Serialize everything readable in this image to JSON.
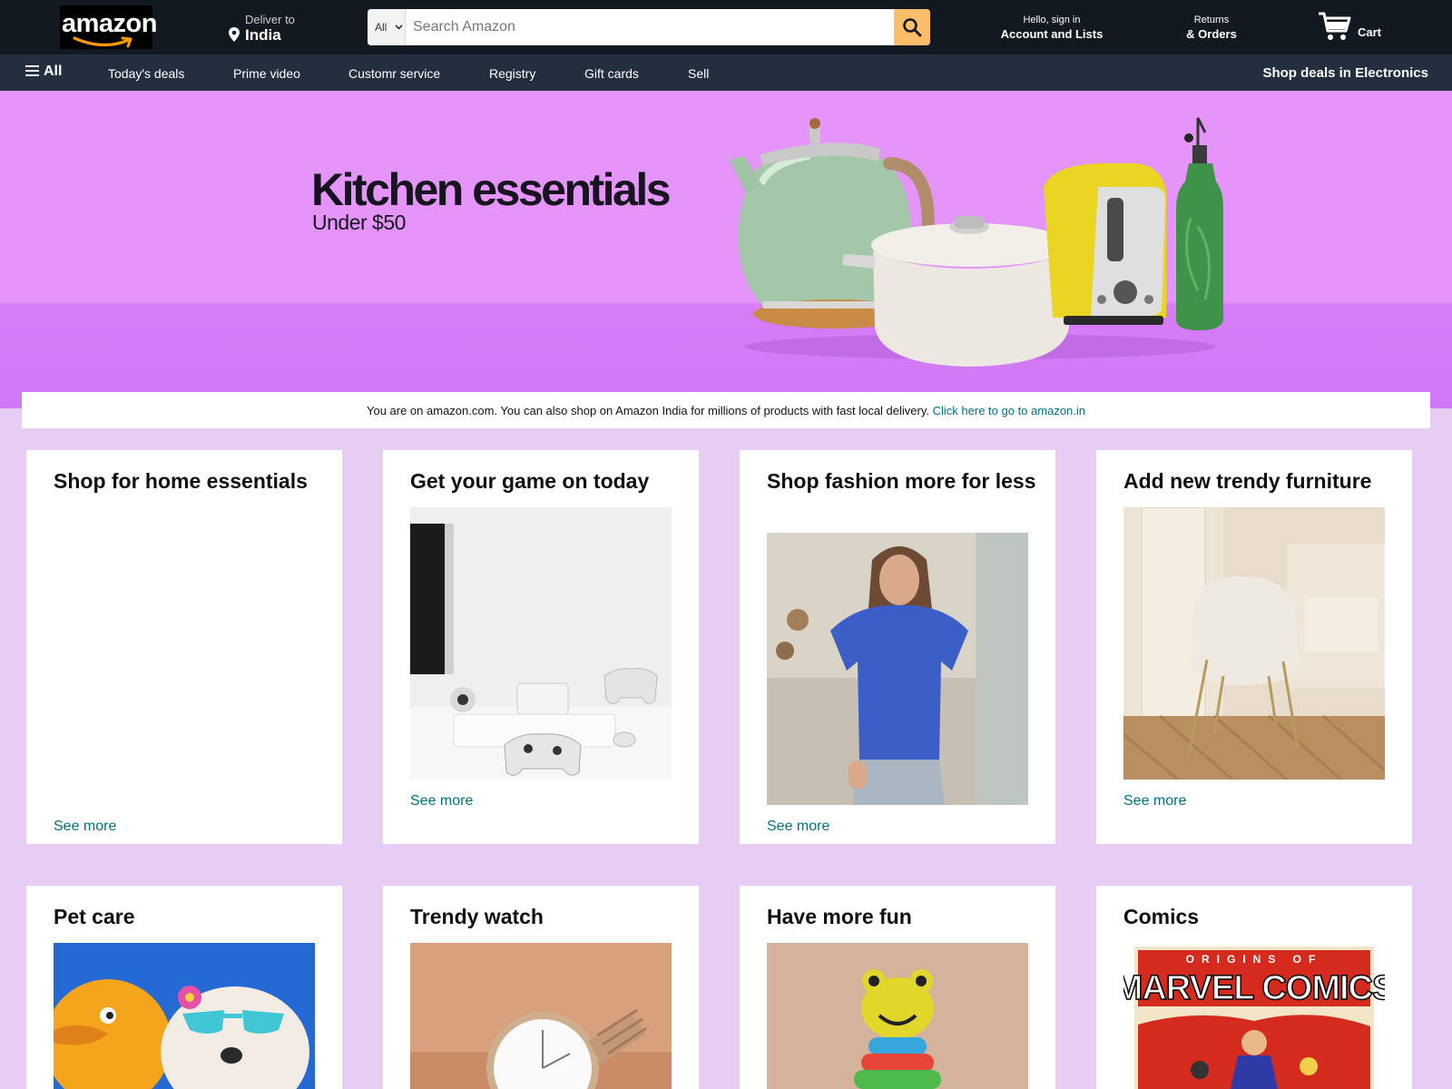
{
  "header": {
    "logo": "amazon",
    "deliver_label": "Deliver to",
    "deliver_location": "India",
    "search": {
      "category": "All",
      "placeholder": "Search Amazon"
    },
    "account_greeting": "Hello, sign in",
    "account_label": "Account and Lists",
    "returns_label": "Returns",
    "orders_label": "& Orders",
    "cart_label": "Cart"
  },
  "subnav": {
    "all_label": "All",
    "links": [
      "Today's deals",
      "Prime video",
      "Customr service",
      "Registry",
      "Gift cards",
      "Sell"
    ],
    "promo": "Shop deals in Electronics"
  },
  "hero": {
    "title": "Kitchen essentials",
    "subtitle": "Under $50"
  },
  "notice": {
    "text": "You are on amazon.com. You can also shop on Amazon India for millions of products with fast local delivery.",
    "link": "Click here to go to amazon.in"
  },
  "cards": [
    {
      "title": "Shop for home essentials",
      "link": "See more"
    },
    {
      "title": "Get your game on today",
      "link": "See more"
    },
    {
      "title": "Shop fashion more for less",
      "link": "See more"
    },
    {
      "title": "Add new trendy furniture",
      "link": "See more"
    },
    {
      "title": "Pet care"
    },
    {
      "title": "Trendy watch"
    },
    {
      "title": "Have more fun"
    },
    {
      "title": "Comics",
      "image_text_top": "ORIGINS OF",
      "image_text_main": "MARVEL COMICS"
    }
  ],
  "colors": {
    "nav_top": "#131921",
    "nav_sub": "#232f3e",
    "search_button": "#febd69",
    "hero_bg": "#e594fa",
    "page_bg": "#e7cdf3",
    "link": "#007185"
  },
  "icons": [
    "location-pin-icon",
    "dropdown-chevron-icon",
    "search-icon",
    "cart-icon",
    "hamburger-menu-icon"
  ]
}
